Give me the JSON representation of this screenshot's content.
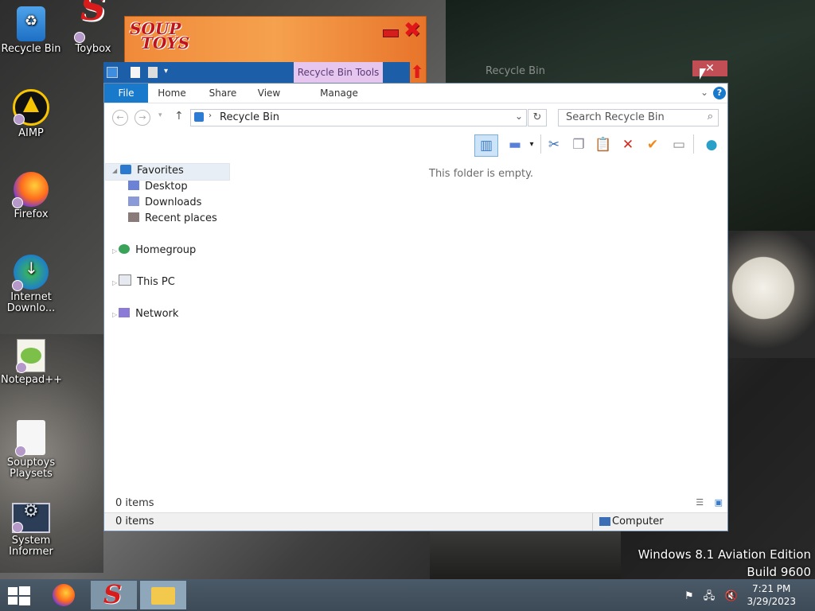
{
  "desktop": {
    "icons": [
      {
        "label": "Recycle Bin",
        "icon": "recycle-bin-icon"
      },
      {
        "label": "Toybox",
        "icon": "toybox-icon"
      },
      {
        "label": "AIMP",
        "icon": "aimp-icon"
      },
      {
        "label": "Firefox",
        "icon": "firefox-icon"
      },
      {
        "label": "Internet Downlo...",
        "icon": "idm-icon"
      },
      {
        "label": "Notepad++",
        "icon": "notepad-plus-plus-icon"
      },
      {
        "label": "Souptoys Playsets",
        "icon": "souptoys-playsets-icon"
      },
      {
        "label": "System Informer",
        "icon": "system-informer-icon"
      }
    ],
    "watermark_line1": "Windows 8.1 Aviation Edition",
    "watermark_line2": "Build 9600"
  },
  "souptoys": {
    "logo_line1": "SOUP",
    "logo_line2": "TOYS"
  },
  "explorer": {
    "title": "Recycle Bin",
    "contextual_tab": "Recycle Bin Tools",
    "tabs": {
      "file": "File",
      "home": "Home",
      "share": "Share",
      "view": "View",
      "manage": "Manage"
    },
    "address": "Recycle Bin",
    "search_placeholder": "Search Recycle Bin",
    "nav": {
      "favorites": "Favorites",
      "desktop": "Desktop",
      "downloads": "Downloads",
      "recent": "Recent places",
      "homegroup": "Homegroup",
      "thispc": "This PC",
      "network": "Network"
    },
    "empty_message": "This folder is empty.",
    "items_count": "0 items",
    "status_items": "0 items",
    "status_zone": "Computer"
  },
  "taskbar": {
    "time": "7:21 PM",
    "date": "3/29/2023"
  }
}
